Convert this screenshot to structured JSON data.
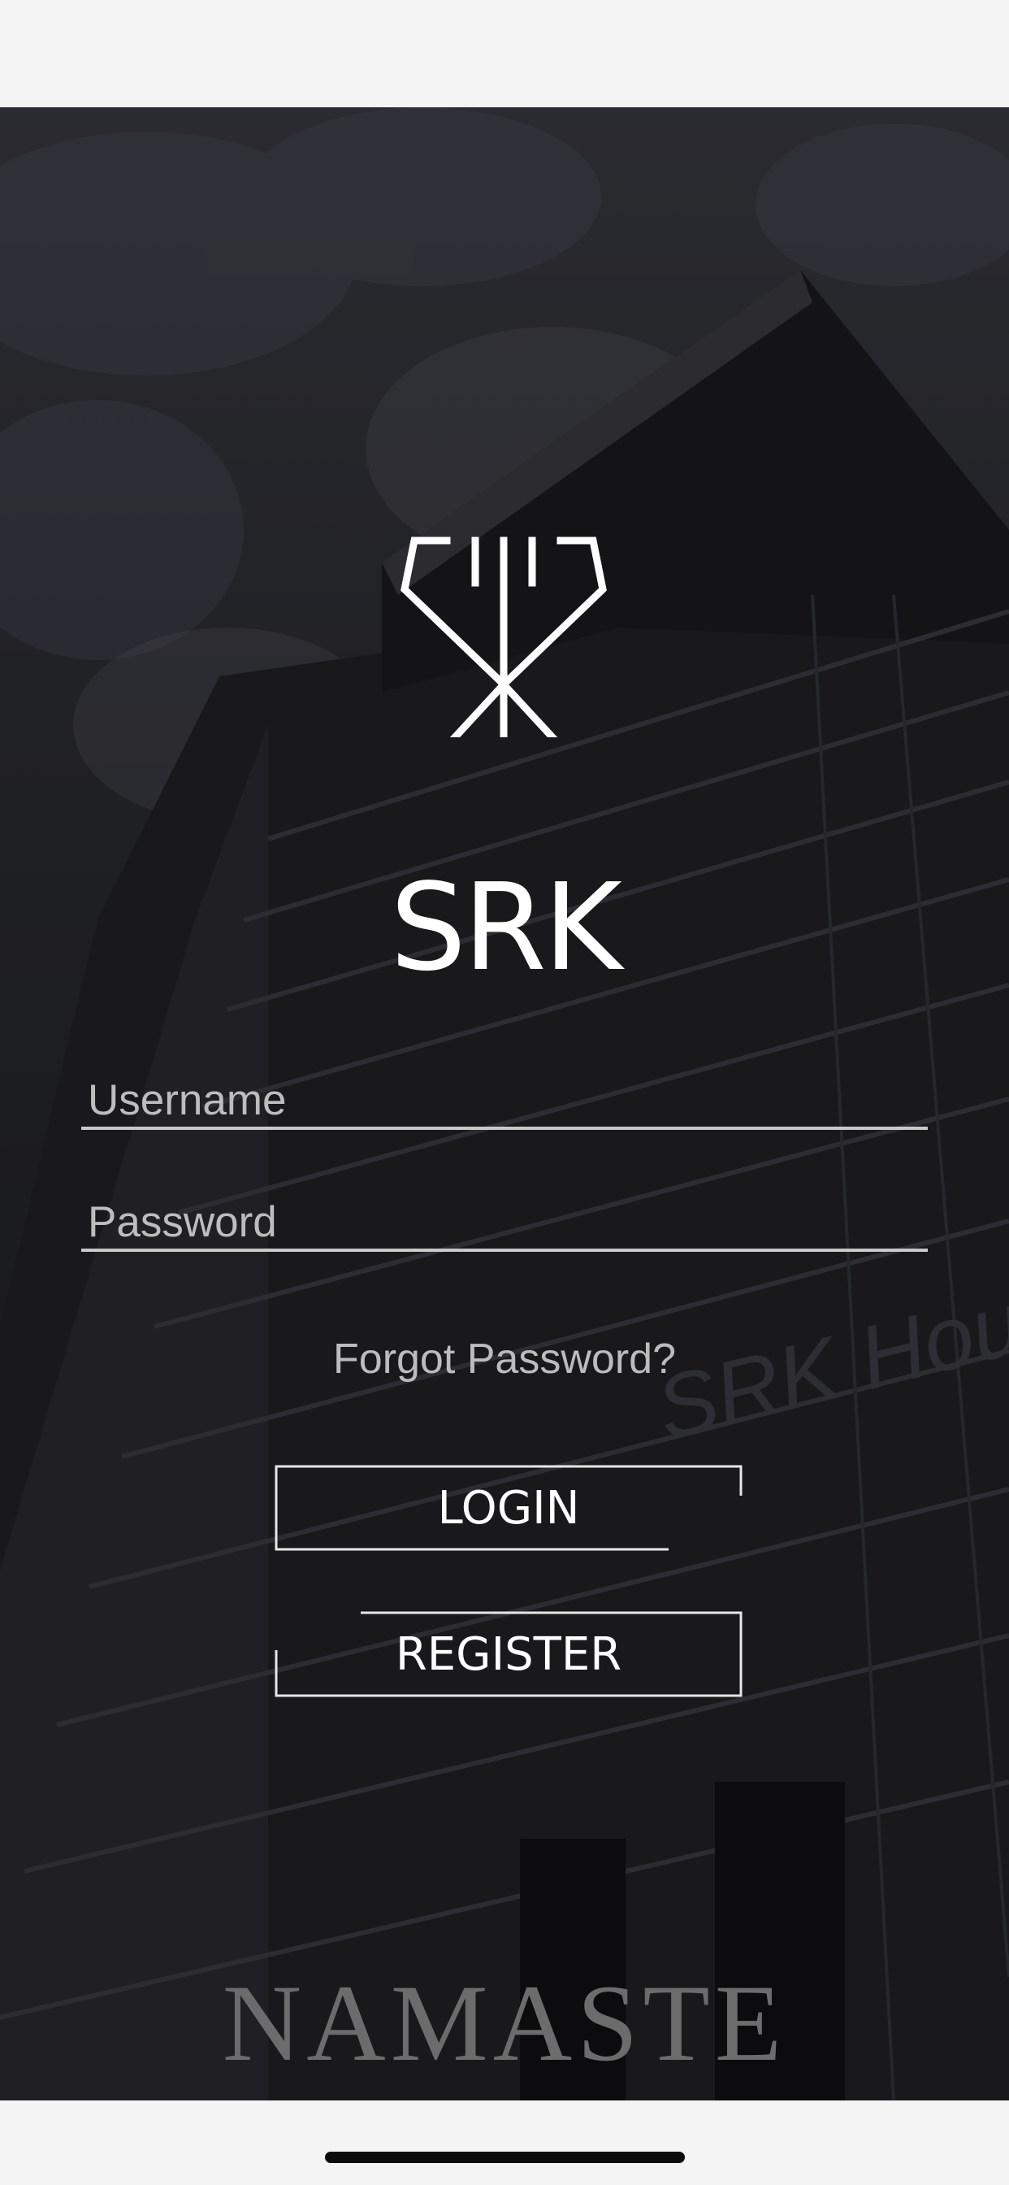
{
  "brand": {
    "logo_icon": "srk-diamond-logo-icon",
    "name": "SRK"
  },
  "background": {
    "image": "building-photo",
    "signage_text": "SRK House",
    "bottom_text": "NAMASTE"
  },
  "form": {
    "username_placeholder": "Username",
    "password_placeholder": "Password",
    "forgot_label": "Forgot Password?"
  },
  "buttons": {
    "login_label": "LOGIN",
    "register_label": "REGISTER"
  },
  "colors": {
    "overlay": "#1d1e22",
    "text": "#ffffff",
    "placeholder": "#bdbdbd",
    "underline": "#c9c9c9"
  }
}
